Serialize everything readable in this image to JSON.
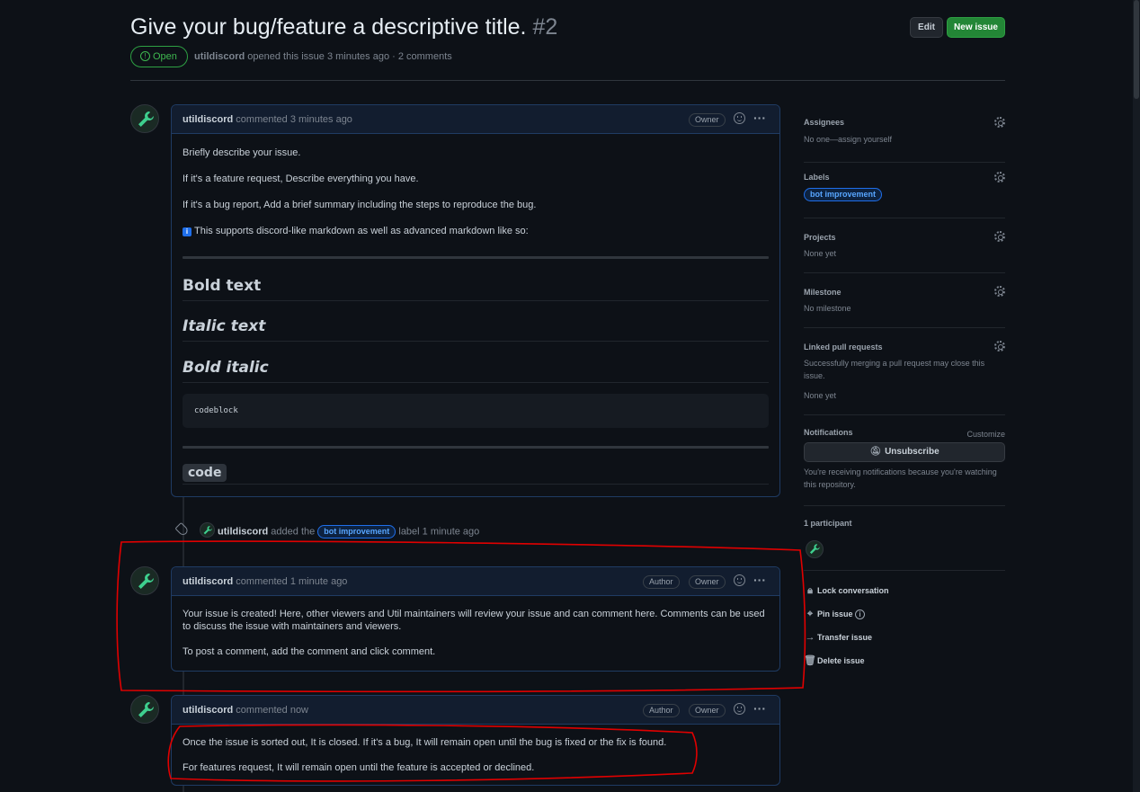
{
  "issue": {
    "title": "Give your bug/feature a descriptive title.",
    "number": "#2",
    "state": "Open",
    "author": "utildiscord",
    "opened_text": "opened this issue 3 minutes ago · 2 comments",
    "edit_label": "Edit",
    "new_issue_label": "New issue"
  },
  "comments": [
    {
      "author": "utildiscord",
      "action": "commented 3 minutes ago",
      "badges": [
        "Owner"
      ],
      "paragraphs": [
        "Briefly describe your issue.",
        "If it's a feature request, Describe everything you have.",
        "If it's a bug report, Add a brief summary including the steps to reproduce the bug.",
        "This supports discord-like markdown as well as advanced markdown like so:"
      ],
      "info_icon": "i",
      "md_bold": "Bold text",
      "md_italic": "Italic text",
      "md_bold_italic": "Bold italic",
      "md_codeblock": "codeblock",
      "md_code": "code"
    },
    {
      "author": "utildiscord",
      "action": "commented 1 minute ago",
      "badges": [
        "Author",
        "Owner"
      ],
      "paragraphs": [
        "Your issue is created! Here, other viewers and Util maintainers will review your issue and can comment here. Comments can be used to discuss the issue with maintainers and viewers.",
        "To post a comment, add the comment and click comment."
      ]
    },
    {
      "author": "utildiscord",
      "action": "commented now",
      "badges": [
        "Author",
        "Owner"
      ],
      "paragraphs": [
        "Once the issue is sorted out, It is closed. If it's a bug, It will remain open until the bug is fixed or the fix is found.",
        "For features request, It will remain open until the feature is accepted or declined."
      ]
    }
  ],
  "event": {
    "actor": "utildiscord",
    "pre": "added the",
    "label": "bot improvement",
    "post": "label 1 minute ago"
  },
  "sidebar": {
    "assignees_title": "Assignees",
    "assignees_value": "No one—assign yourself",
    "labels_title": "Labels",
    "label_chip": "bot improvement",
    "projects_title": "Projects",
    "projects_value": "None yet",
    "milestone_title": "Milestone",
    "milestone_value": "No milestone",
    "linked_title": "Linked pull requests",
    "linked_desc": "Successfully merging a pull request may close this issue.",
    "linked_value": "None yet",
    "notifications_title": "Notifications",
    "customize_label": "Customize",
    "unsubscribe_label": "Unsubscribe",
    "notifications_desc": "You're receiving notifications because you're watching this repository.",
    "participants_title": "1 participant",
    "actions": [
      "Lock conversation",
      "Pin issue",
      "Transfer issue",
      "Delete issue"
    ]
  },
  "colors": {
    "accent_green": "#238636",
    "open_green": "#3fb950",
    "label_blue": "#58a6ff",
    "annotation_red": "#e00000"
  },
  "icons": [
    "issue-open-icon",
    "smiley-icon",
    "kebab-icon",
    "tag-icon",
    "gear-icon",
    "bell-slash-icon",
    "lock-icon",
    "pin-icon",
    "info-icon",
    "arrow-right-icon",
    "trash-icon",
    "wrench-avatar-icon"
  ]
}
